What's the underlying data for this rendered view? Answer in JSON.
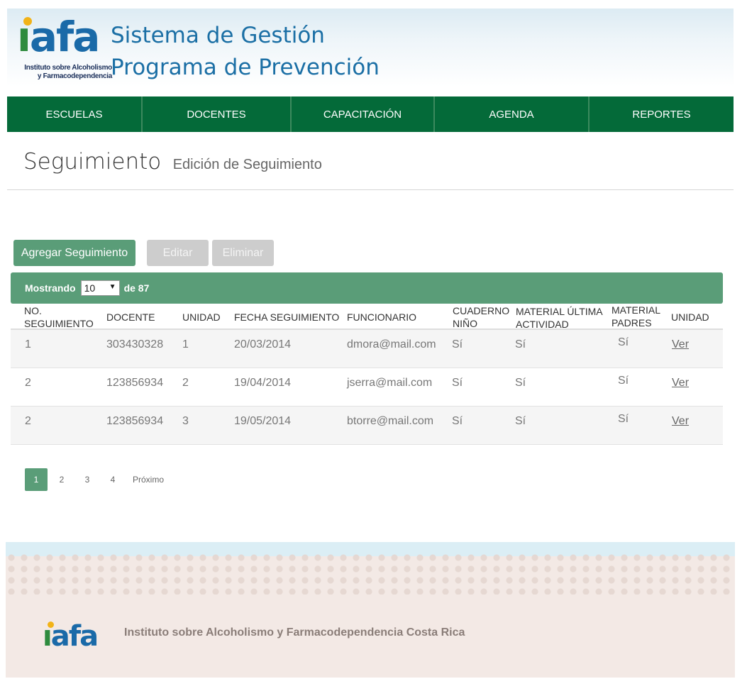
{
  "header": {
    "logo_text": "iafa",
    "logo_subtitle": "Instituto sobre Alcoholismo y Farmacodependencia",
    "title_line1": "Sistema de Gestión",
    "title_line2": "Programa de Prevención"
  },
  "nav": {
    "items": [
      "ESCUELAS",
      "DOCENTES",
      "CAPACITACIÓN",
      "AGENDA",
      "REPORTES"
    ]
  },
  "page": {
    "title": "Seguimiento",
    "subtitle": "Edición de Seguimiento"
  },
  "actions": {
    "add": "Agregar Seguimiento",
    "edit": "Editar",
    "delete": "Eliminar"
  },
  "listing": {
    "showing_label": "Mostrando",
    "page_size": "10",
    "total_label": "de 87"
  },
  "table": {
    "headers": {
      "no_line1": "NO.",
      "no_line2": "SEGUIMIENTO",
      "docente": "DOCENTE",
      "unidad": "UNIDAD",
      "fecha": "FECHA SEGUIMIENTO",
      "funcionario": "FUNCIONARIO",
      "cuaderno_line1": "CUADERNO",
      "cuaderno_line2": "NIÑO",
      "material_line1": "MATERIAL ÚLTIMA",
      "material_line2": "ACTIVIDAD",
      "padres_line1": "MATERIAL",
      "padres_line2": "PADRES",
      "unidad2": "UNIDAD"
    },
    "rows": [
      {
        "no": "1",
        "docente": "303430328",
        "unidad": "1",
        "fecha": "20/03/2014",
        "funcionario": "dmora@mail.com",
        "cuaderno": "Sí",
        "material": "Sí",
        "padres": "Sí",
        "action": "Ver"
      },
      {
        "no": "2",
        "docente": "123856934",
        "unidad": "2",
        "fecha": "19/04/2014",
        "funcionario": "jserra@mail.com",
        "cuaderno": "Sí",
        "material": "Sí",
        "padres": "Sí",
        "action": "Ver"
      },
      {
        "no": "2",
        "docente": "123856934",
        "unidad": "3",
        "fecha": "19/05/2014",
        "funcionario": "btorre@mail.com",
        "cuaderno": "Sí",
        "material": "Sí",
        "padres": "Sí",
        "action": "Ver"
      }
    ]
  },
  "pagination": {
    "pages": [
      "1",
      "2",
      "3",
      "4"
    ],
    "active": "1",
    "next": "Próximo"
  },
  "footer": {
    "logo_text": "iafa",
    "text": "Instituto sobre Alcoholismo y Farmacodependencia Costa Rica"
  },
  "colors": {
    "nav": "#046a39",
    "accent": "#5a9d78",
    "title_blue": "#1b6fa5"
  }
}
